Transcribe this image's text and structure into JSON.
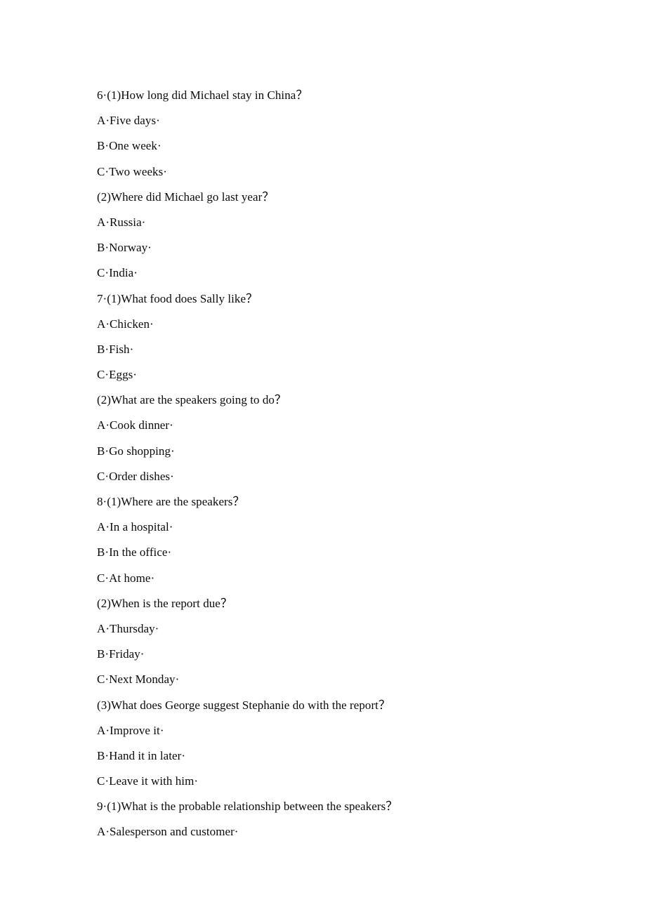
{
  "document": {
    "type": "listening-comprehension-worksheet",
    "background_color": "#ffffff",
    "text_color": "#0a0a0a",
    "lines": [
      {
        "kind": "stem",
        "text": "6·(1)How long did Michael stay in China？"
      },
      {
        "kind": "option",
        "text": "A·Five days·"
      },
      {
        "kind": "option",
        "text": "B·One week·"
      },
      {
        "kind": "option",
        "text": "C·Two weeks·"
      },
      {
        "kind": "subq",
        "text": "(2)Where did Michael go last year？"
      },
      {
        "kind": "option",
        "text": "A·Russia·"
      },
      {
        "kind": "option",
        "text": "B·Norway·"
      },
      {
        "kind": "option",
        "text": "C·India·"
      },
      {
        "kind": "stem",
        "text": "7·(1)What food does Sally like？"
      },
      {
        "kind": "option",
        "text": "A·Chicken·"
      },
      {
        "kind": "option",
        "text": "B·Fish·"
      },
      {
        "kind": "option",
        "text": "C·Eggs·"
      },
      {
        "kind": "subq",
        "text": "(2)What are the speakers going to do？"
      },
      {
        "kind": "option",
        "text": "A·Cook dinner·"
      },
      {
        "kind": "option",
        "text": "B·Go shopping·"
      },
      {
        "kind": "option",
        "text": "C·Order dishes·"
      },
      {
        "kind": "stem",
        "text": "8·(1)Where are the speakers？"
      },
      {
        "kind": "option",
        "text": "A·In a hospital·"
      },
      {
        "kind": "option",
        "text": "B·In the office·"
      },
      {
        "kind": "option",
        "text": "C·At home·"
      },
      {
        "kind": "subq",
        "text": "(2)When is the report due？"
      },
      {
        "kind": "option",
        "text": "A·Thursday·"
      },
      {
        "kind": "option",
        "text": "B·Friday·"
      },
      {
        "kind": "option",
        "text": "C·Next Monday·"
      },
      {
        "kind": "subq",
        "text": "(3)What does George suggest Stephanie do with the report？"
      },
      {
        "kind": "option",
        "text": "A·Improve it·"
      },
      {
        "kind": "option",
        "text": "B·Hand it in later·"
      },
      {
        "kind": "option",
        "text": "C·Leave it with him·"
      },
      {
        "kind": "stem",
        "text": "9·(1)What is the probable relationship between the speakers？"
      },
      {
        "kind": "option",
        "text": "A·Salesperson and customer·"
      }
    ]
  }
}
